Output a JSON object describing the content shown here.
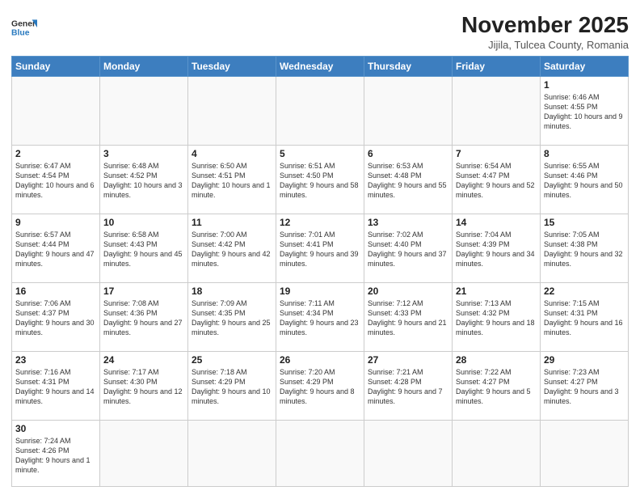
{
  "header": {
    "logo_general": "General",
    "logo_blue": "Blue",
    "month": "November 2025",
    "location": "Jijila, Tulcea County, Romania"
  },
  "weekdays": [
    "Sunday",
    "Monday",
    "Tuesday",
    "Wednesday",
    "Thursday",
    "Friday",
    "Saturday"
  ],
  "weeks": [
    [
      {
        "day": "",
        "info": ""
      },
      {
        "day": "",
        "info": ""
      },
      {
        "day": "",
        "info": ""
      },
      {
        "day": "",
        "info": ""
      },
      {
        "day": "",
        "info": ""
      },
      {
        "day": "",
        "info": ""
      },
      {
        "day": "1",
        "info": "Sunrise: 6:46 AM\nSunset: 4:55 PM\nDaylight: 10 hours and 9 minutes."
      }
    ],
    [
      {
        "day": "2",
        "info": "Sunrise: 6:47 AM\nSunset: 4:54 PM\nDaylight: 10 hours and 6 minutes."
      },
      {
        "day": "3",
        "info": "Sunrise: 6:48 AM\nSunset: 4:52 PM\nDaylight: 10 hours and 3 minutes."
      },
      {
        "day": "4",
        "info": "Sunrise: 6:50 AM\nSunset: 4:51 PM\nDaylight: 10 hours and 1 minute."
      },
      {
        "day": "5",
        "info": "Sunrise: 6:51 AM\nSunset: 4:50 PM\nDaylight: 9 hours and 58 minutes."
      },
      {
        "day": "6",
        "info": "Sunrise: 6:53 AM\nSunset: 4:48 PM\nDaylight: 9 hours and 55 minutes."
      },
      {
        "day": "7",
        "info": "Sunrise: 6:54 AM\nSunset: 4:47 PM\nDaylight: 9 hours and 52 minutes."
      },
      {
        "day": "8",
        "info": "Sunrise: 6:55 AM\nSunset: 4:46 PM\nDaylight: 9 hours and 50 minutes."
      }
    ],
    [
      {
        "day": "9",
        "info": "Sunrise: 6:57 AM\nSunset: 4:44 PM\nDaylight: 9 hours and 47 minutes."
      },
      {
        "day": "10",
        "info": "Sunrise: 6:58 AM\nSunset: 4:43 PM\nDaylight: 9 hours and 45 minutes."
      },
      {
        "day": "11",
        "info": "Sunrise: 7:00 AM\nSunset: 4:42 PM\nDaylight: 9 hours and 42 minutes."
      },
      {
        "day": "12",
        "info": "Sunrise: 7:01 AM\nSunset: 4:41 PM\nDaylight: 9 hours and 39 minutes."
      },
      {
        "day": "13",
        "info": "Sunrise: 7:02 AM\nSunset: 4:40 PM\nDaylight: 9 hours and 37 minutes."
      },
      {
        "day": "14",
        "info": "Sunrise: 7:04 AM\nSunset: 4:39 PM\nDaylight: 9 hours and 34 minutes."
      },
      {
        "day": "15",
        "info": "Sunrise: 7:05 AM\nSunset: 4:38 PM\nDaylight: 9 hours and 32 minutes."
      }
    ],
    [
      {
        "day": "16",
        "info": "Sunrise: 7:06 AM\nSunset: 4:37 PM\nDaylight: 9 hours and 30 minutes."
      },
      {
        "day": "17",
        "info": "Sunrise: 7:08 AM\nSunset: 4:36 PM\nDaylight: 9 hours and 27 minutes."
      },
      {
        "day": "18",
        "info": "Sunrise: 7:09 AM\nSunset: 4:35 PM\nDaylight: 9 hours and 25 minutes."
      },
      {
        "day": "19",
        "info": "Sunrise: 7:11 AM\nSunset: 4:34 PM\nDaylight: 9 hours and 23 minutes."
      },
      {
        "day": "20",
        "info": "Sunrise: 7:12 AM\nSunset: 4:33 PM\nDaylight: 9 hours and 21 minutes."
      },
      {
        "day": "21",
        "info": "Sunrise: 7:13 AM\nSunset: 4:32 PM\nDaylight: 9 hours and 18 minutes."
      },
      {
        "day": "22",
        "info": "Sunrise: 7:15 AM\nSunset: 4:31 PM\nDaylight: 9 hours and 16 minutes."
      }
    ],
    [
      {
        "day": "23",
        "info": "Sunrise: 7:16 AM\nSunset: 4:31 PM\nDaylight: 9 hours and 14 minutes."
      },
      {
        "day": "24",
        "info": "Sunrise: 7:17 AM\nSunset: 4:30 PM\nDaylight: 9 hours and 12 minutes."
      },
      {
        "day": "25",
        "info": "Sunrise: 7:18 AM\nSunset: 4:29 PM\nDaylight: 9 hours and 10 minutes."
      },
      {
        "day": "26",
        "info": "Sunrise: 7:20 AM\nSunset: 4:29 PM\nDaylight: 9 hours and 8 minutes."
      },
      {
        "day": "27",
        "info": "Sunrise: 7:21 AM\nSunset: 4:28 PM\nDaylight: 9 hours and 7 minutes."
      },
      {
        "day": "28",
        "info": "Sunrise: 7:22 AM\nSunset: 4:27 PM\nDaylight: 9 hours and 5 minutes."
      },
      {
        "day": "29",
        "info": "Sunrise: 7:23 AM\nSunset: 4:27 PM\nDaylight: 9 hours and 3 minutes."
      }
    ],
    [
      {
        "day": "30",
        "info": "Sunrise: 7:24 AM\nSunset: 4:26 PM\nDaylight: 9 hours and 1 minute."
      },
      {
        "day": "",
        "info": ""
      },
      {
        "day": "",
        "info": ""
      },
      {
        "day": "",
        "info": ""
      },
      {
        "day": "",
        "info": ""
      },
      {
        "day": "",
        "info": ""
      },
      {
        "day": "",
        "info": ""
      }
    ]
  ]
}
